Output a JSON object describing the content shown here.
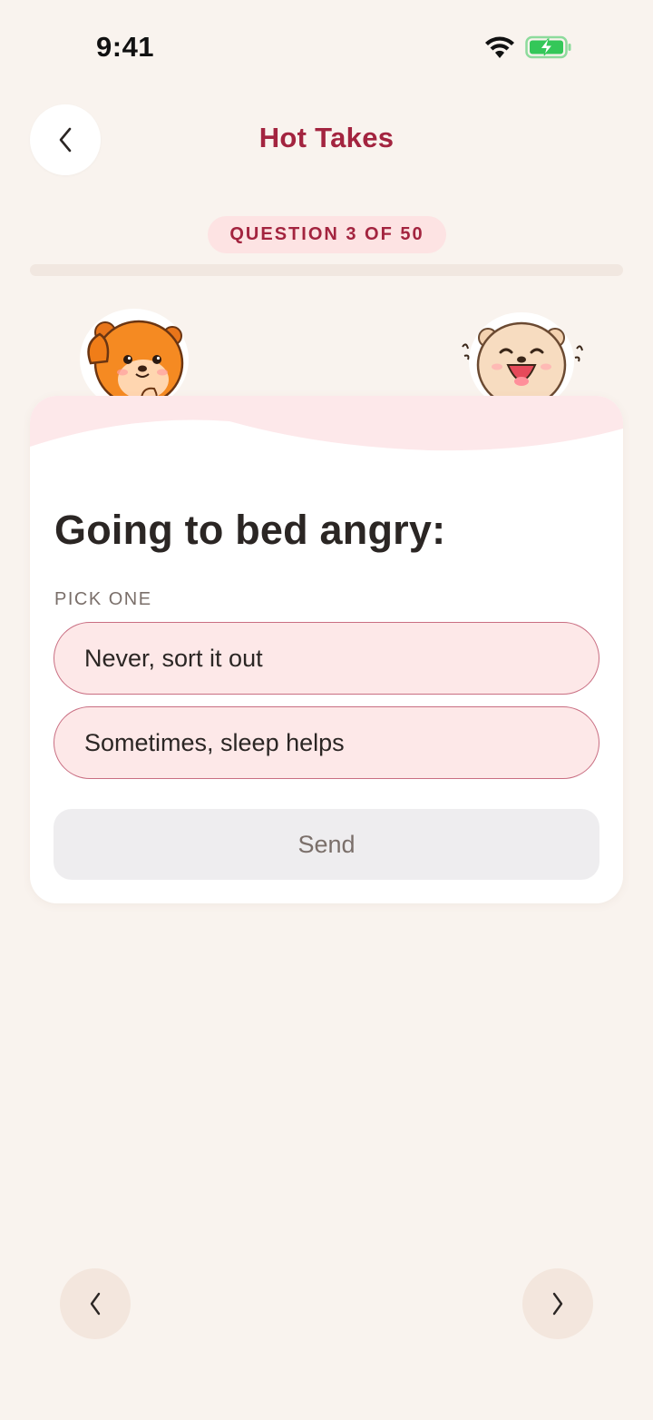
{
  "status_bar": {
    "time": "9:41",
    "wifi_icon": "wifi-icon",
    "battery_icon": "battery-charging-icon",
    "battery_color": "#34c759"
  },
  "header": {
    "back_icon": "chevron-left-icon",
    "title": "Hot Takes"
  },
  "progress": {
    "badge": "QUESTION 3 OF 50",
    "current": 3,
    "total": 50
  },
  "mascots": {
    "left": "orange-otter-thinking",
    "right": "beige-otter-laughing"
  },
  "card": {
    "question": "Going to bed angry:",
    "pick_label": "PICK ONE",
    "options": [
      {
        "label": "Never, sort it out"
      },
      {
        "label": "Sometimes, sleep helps"
      }
    ],
    "send_label": "Send"
  },
  "nav": {
    "prev_icon": "chevron-left-icon",
    "next_icon": "chevron-right-icon"
  },
  "colors": {
    "background": "#f9f3ee",
    "accent": "#a3243f",
    "option_fill": "#fde8e8",
    "option_border": "#c96e82",
    "badge_fill": "#fde3e3"
  }
}
